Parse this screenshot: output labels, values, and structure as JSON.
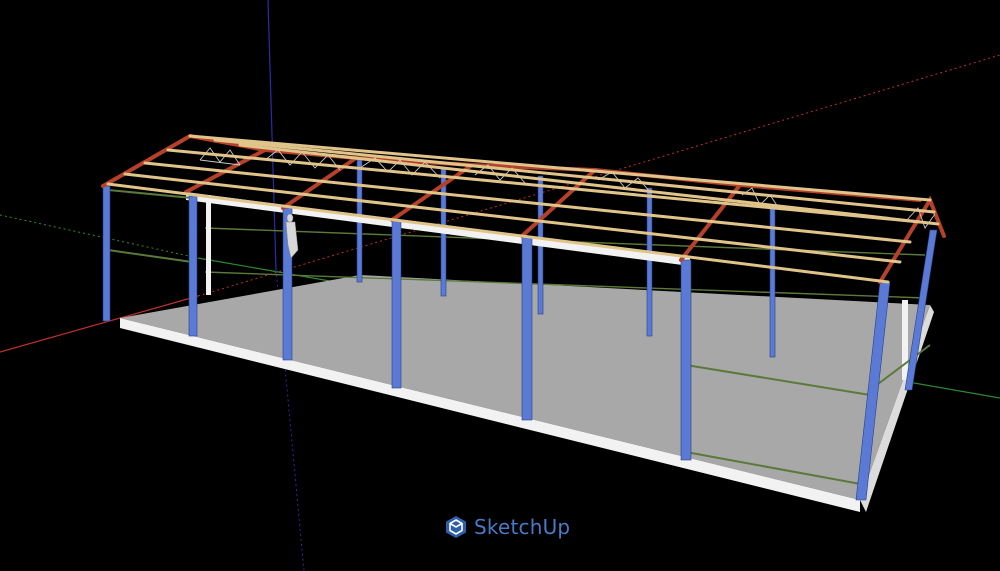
{
  "app": {
    "watermark_text": "SketchUp"
  },
  "colors": {
    "background": "#000000",
    "axis_red": "#c0302c",
    "axis_green": "#2e8a2e",
    "axis_blue": "#2b2ba8",
    "column": "#5a7ad6",
    "column_dark": "#3a56a8",
    "rafter": "#b5412a",
    "purlin": "#e0c48a",
    "girt": "#5b7a3a",
    "floor": "#a8a8a8",
    "slab": "#f2f2f2",
    "brand": "#4a79c6"
  },
  "icons": {
    "logo": "sketchup-logo-icon"
  }
}
